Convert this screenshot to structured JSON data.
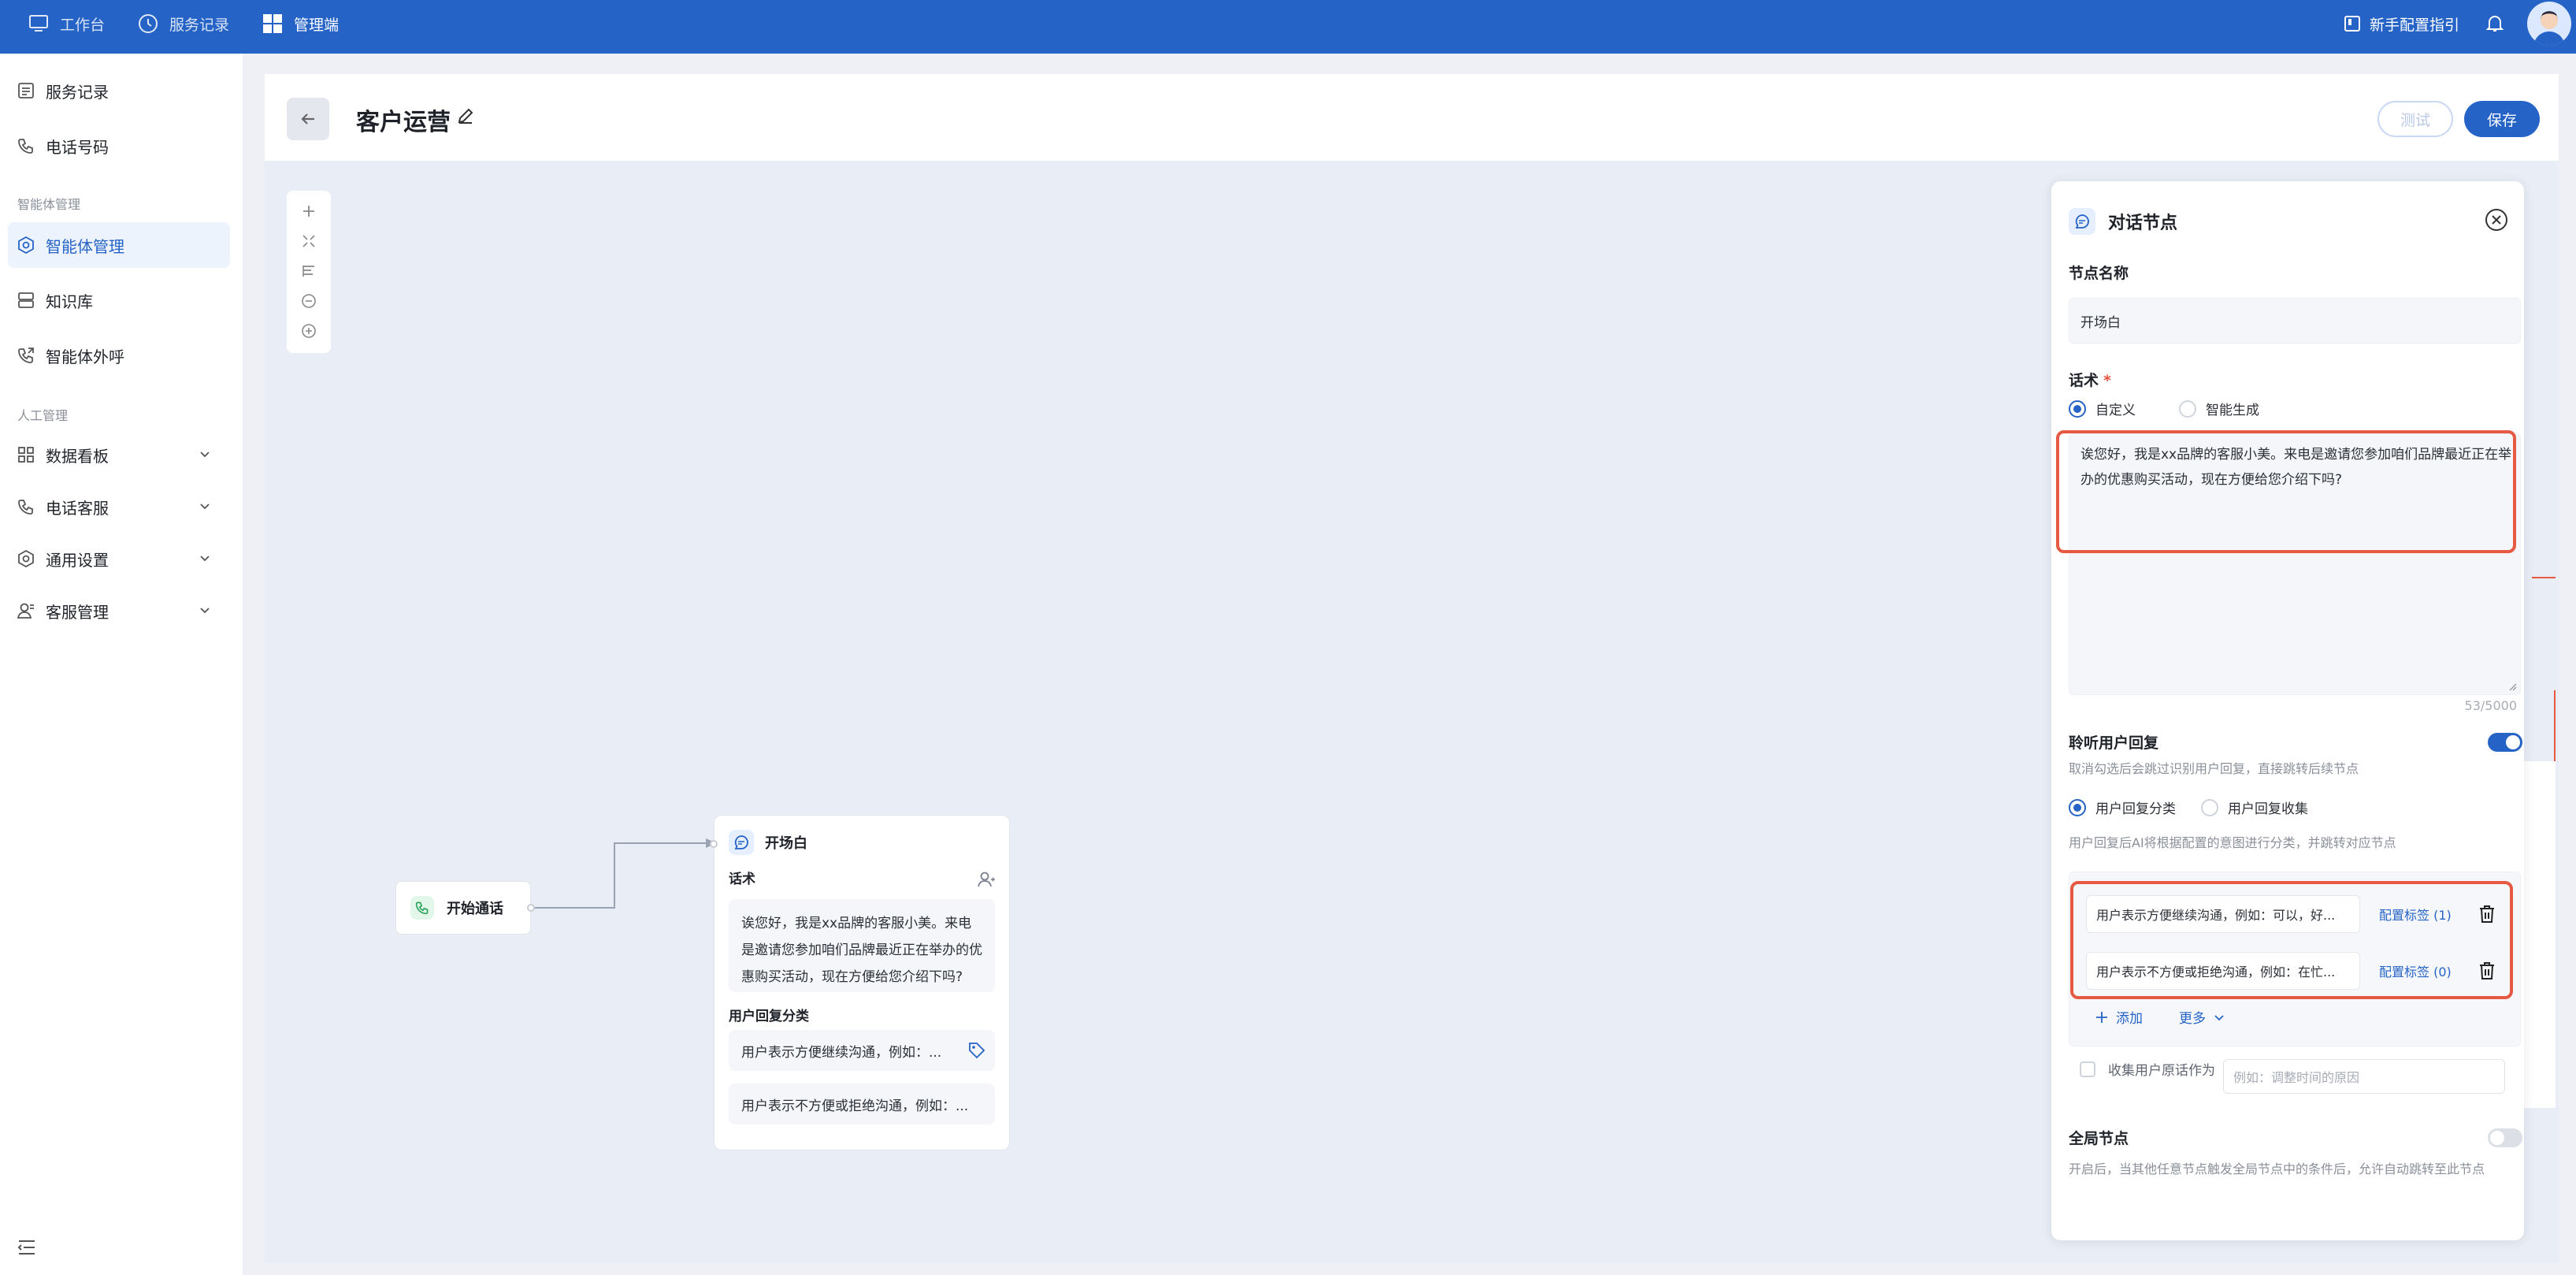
{
  "topbar": {
    "nav": [
      "工作台",
      "服务记录",
      "管理端"
    ],
    "guide": "新手配置指引"
  },
  "sidebar": {
    "items_a": [
      "服务记录",
      "电话号码"
    ],
    "group1": "智能体管理",
    "items_b": [
      "智能体管理",
      "知识库",
      "智能体外呼"
    ],
    "group2": "人工管理",
    "items_c": [
      "数据看板",
      "电话客服",
      "通用设置",
      "客服管理"
    ]
  },
  "header": {
    "title": "客户运营",
    "test_label": "测试",
    "save_label": "保存"
  },
  "canvas": {
    "start_node": "开始通话",
    "open_node": {
      "title": "开场白",
      "script_label": "话术",
      "script_text": "诶您好，我是xx品牌的客服小美。来电是邀请您参加咱们品牌最近正在举办的优惠购买活动，现在方便给您介绍下吗?",
      "intent_label": "用户回复分类",
      "intents": [
        "用户表示方便继续沟通，例如：...",
        "用户表示不方便或拒绝沟通，例如：..."
      ]
    }
  },
  "panel": {
    "title": "对话节点",
    "name_label": "节点名称",
    "name_value": "开场白",
    "script_label": "话术",
    "required_mark": "*",
    "script_modes": [
      "自定义",
      "智能生成"
    ],
    "script_text": "诶您好，我是xx品牌的客服小美。来电是邀请您参加咱们品牌最近正在举办的优惠购买活动，现在方便给您介绍下吗?",
    "char_count": "53/5000",
    "listen_label": "聆听用户回复",
    "listen_on": true,
    "listen_hint": "取消勾选后会跳过识别用户回复，直接跳转后续节点",
    "reply_modes": [
      "用户回复分类",
      "用户回复收集"
    ],
    "reply_hint": "用户回复后AI将根据配置的意图进行分类，并跳转对应节点",
    "intents": [
      {
        "text": "用户表示方便继续沟通，例如：可以，好...",
        "link": "配置标签 (1)"
      },
      {
        "text": "用户表示不方便或拒绝沟通，例如：在忙...",
        "link": "配置标签 (0)"
      }
    ],
    "add_label": "添加",
    "more_label": "更多",
    "collect_label": "收集用户原话作为",
    "collect_placeholder": "例如：调整时间的原因",
    "global_label": "全局节点",
    "global_on": false,
    "global_hint": "开启后，当其他任意节点触发全局节点中的条件后，允许自动跳转至此节点"
  },
  "colors": {
    "brand": "#2563c6",
    "highlight": "#e65a43"
  }
}
